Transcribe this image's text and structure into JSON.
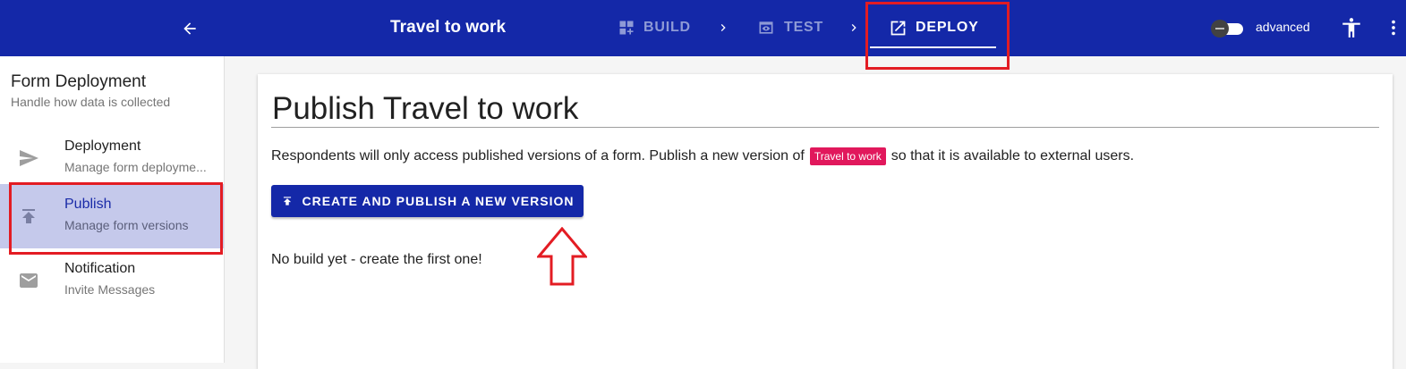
{
  "header": {
    "form_title": "Travel to work",
    "steps": [
      {
        "label": "BUILD",
        "icon": "dashboard-add-icon"
      },
      {
        "label": "TEST",
        "icon": "preview-eye-icon"
      },
      {
        "label": "DEPLOY",
        "icon": "open-in-new-icon"
      }
    ],
    "active_step": "DEPLOY",
    "advanced_label": "advanced",
    "advanced_enabled": false,
    "colors": {
      "bar": "#1428a8",
      "highlight": "#e31c23"
    }
  },
  "sidebar": {
    "title": "Form Deployment",
    "subtitle": "Handle how data is collected",
    "items": [
      {
        "label": "Deployment",
        "desc": "Manage form deployme...",
        "icon": "send-icon"
      },
      {
        "label": "Publish",
        "desc": "Manage form versions",
        "icon": "publish-icon",
        "active": true
      },
      {
        "label": "Notification",
        "desc": "Invite Messages",
        "icon": "mail-icon"
      }
    ]
  },
  "main": {
    "title": "Publish Travel to work",
    "intro_before": "Respondents will only access published versions of a form. Publish a new version of",
    "form_chip": "Travel to work",
    "intro_after": "so that it is available to external users.",
    "publish_button": "CREATE AND PUBLISH A NEW VERSION",
    "empty_state": "No build yet - create the first one!",
    "chip_color": "#e1185c"
  }
}
